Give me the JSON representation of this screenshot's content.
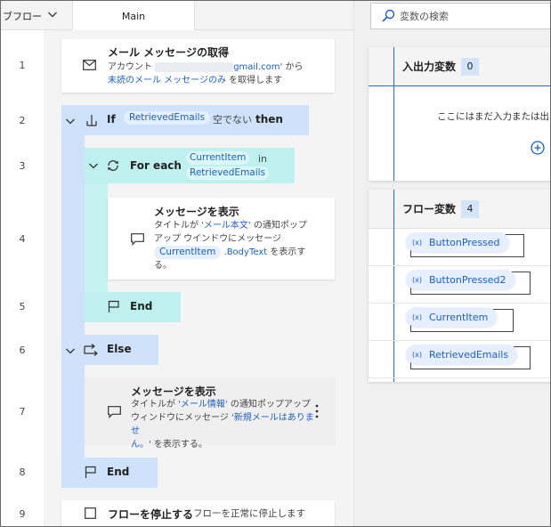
{
  "tabs": {
    "subflows_label": "ブフロー",
    "main_label": "Main"
  },
  "lines": [
    "1",
    "2",
    "3",
    "4",
    "5",
    "6",
    "7",
    "8",
    "9"
  ],
  "steps": {
    "get_mail": {
      "title": "メール メッセージの取得",
      "desc_prefix": "アカウント",
      "email_domain": "gmail.com'",
      "desc_from": " から",
      "link": "未読のメール メッセージのみ",
      "desc_suffix": " を取得します"
    },
    "if": {
      "keyword": "If",
      "variable": "RetrievedEmails",
      "condition": "空でない",
      "then": "then"
    },
    "foreach": {
      "keyword": "For each",
      "item": "CurrentItem",
      "in": "in",
      "collection": "RetrievedEmails"
    },
    "show_msg_1": {
      "title": "メッセージを表示",
      "t1": "タイトルが ",
      "l1": "'メール本文'",
      "t2": " の通知ポップ",
      "t3": "アップ ウインドウにメッセージ",
      "var": "CurrentItem",
      "prop": " .BodyText",
      "t4": " を表示す",
      "t5": "る。"
    },
    "end_foreach": {
      "label": "End"
    },
    "else": {
      "label": "Else"
    },
    "show_msg_2": {
      "title": "メッセージを表示",
      "t1": "タイトルが ",
      "l1": "'メール情報'",
      "t2": " の通知ポップアップ",
      "t3": "ウィンドウにメッセージ ",
      "l2a": "'新規メールはありませ",
      "l2b": "ん。'",
      "t4": " を表示する。"
    },
    "end_if": {
      "label": "End"
    },
    "stop_flow": {
      "title": "フローを停止する",
      "desc": "フローを正常に停止します"
    }
  },
  "variables": {
    "search_placeholder": "変数の検索",
    "io": {
      "title": "入出力変数",
      "count": "0",
      "empty_text": "ここにはまだ入力または出力"
    },
    "flow": {
      "title": "フロー変数",
      "count": "4",
      "items": [
        "ButtonPressed",
        "ButtonPressed2",
        "CurrentItem",
        "RetrievedEmails"
      ]
    }
  },
  "colors": {
    "scope_blue": "#d0e2fb",
    "scope_cyan": "#c6f2f2",
    "link_blue": "#1a5fc4",
    "accent_line": "#2a66d6"
  }
}
